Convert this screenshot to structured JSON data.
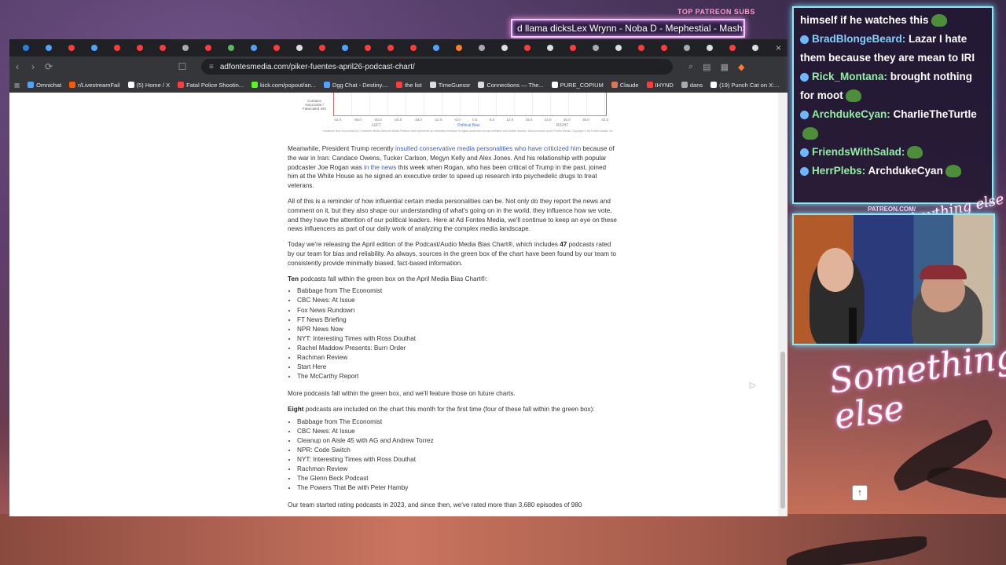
{
  "overlay": {
    "top_patreon_label": "TOP PATREON SUBS",
    "marquee_text": "d llama dicksLex Wrynn -  Noba D - Mephestial - MashStr",
    "patreon_url": "PATREON.COM/",
    "anything_else_script": "Anything else",
    "something_else_script": "Something else",
    "chat": [
      {
        "name": "",
        "message": "himself if he watches this",
        "emote": true,
        "name_color": "green",
        "badge": false
      },
      {
        "name": "BradBlongeBeard:",
        "message": " Lazar I hate them because they are mean to IRI",
        "emote": false,
        "name_color": "blue",
        "badge": true
      },
      {
        "name": "Rick_Montana:",
        "message": " brought nothing for moot",
        "emote": true,
        "name_color": "green",
        "badge": true
      },
      {
        "name": "ArchdukeCyan:",
        "message": " CharlieTheTurtle",
        "emote": true,
        "name_color": "green",
        "badge": true
      },
      {
        "name": "FriendsWithSalad:",
        "message": "",
        "emote": true,
        "name_color": "green",
        "badge": true
      },
      {
        "name": "HerrPlebs:",
        "message": " ArchdukeCyan",
        "emote": true,
        "name_color": "green",
        "badge": true
      }
    ]
  },
  "browser": {
    "url": "adfontesmedia.com/piker-fuentes-april26-podcast-chart/",
    "tab_colors": [
      "#2a7de1",
      "#4fa3ff",
      "#ff3b3b",
      "#4fa3ff",
      "#ff3b3b",
      "#ff3b3b",
      "#ff3b3b",
      "#aaaaaa",
      "#ff3b3b",
      "#5cb85c",
      "#4fa3ff",
      "#ff3b3b",
      "#dddddd",
      "#ff3b3b",
      "#4fa3ff",
      "#ff3b3b",
      "#ff3b3b",
      "#ff3b3b",
      "#4fa3ff",
      "#ff7b2b",
      "#aaaaaa",
      "#dddddd",
      "#ff3b3b",
      "#dddddd",
      "#ff3b3b",
      "#aaaaaa",
      "#dddddd",
      "#ff3b3b",
      "#ff3b3b",
      "#aaaaaa",
      "#dddddd",
      "#ff3b3b",
      "#dddddd"
    ],
    "tab_close": "×",
    "bookmarks": [
      {
        "label": "Omnichat",
        "color": "#4fa3ff"
      },
      {
        "label": "r/LivestreamFail",
        "color": "#ff5700"
      },
      {
        "label": "(5) Home / X",
        "color": "#ffffff"
      },
      {
        "label": "Fatal Police Shootin...",
        "color": "#ff3b3b"
      },
      {
        "label": "kick.com/popout/an...",
        "color": "#53fc18"
      },
      {
        "label": "Dgg Chat - Destiny....",
        "color": "#4fa3ff"
      },
      {
        "label": "the list",
        "color": "#ff3b3b"
      },
      {
        "label": "TimeGuessr",
        "color": "#dddddd"
      },
      {
        "label": "Connections — The...",
        "color": "#dddddd"
      },
      {
        "label": "PURE_COPIUM",
        "color": "#ffffff"
      },
      {
        "label": "Claude",
        "color": "#d97757"
      },
      {
        "label": "IHYND",
        "color": "#ff3b3b"
      },
      {
        "label": "dans",
        "color": "#aaaaaa"
      },
      {
        "label": "(19) Punch Cat on X:...",
        "color": "#ffffff"
      }
    ]
  },
  "chart_fragment": {
    "ylabel": "Contains Inaccurate / Fabricated Info",
    "ticks": [
      "-42.0",
      "-36.0",
      "-30.0",
      "-24.0",
      "-18.0",
      "-12.0",
      "-6.0",
      "0.0",
      "6.0",
      "12.0",
      "18.0",
      "24.0",
      "30.0",
      "36.0",
      "42.0"
    ],
    "left_label": "LEFT",
    "mid_label": "Political Bias",
    "right_label": "RIGHT",
    "footnote": "* Audience Size is provided by Consumer Media Network Media Platform and represents an estimated measure of digital audiences across websites and mobile devices. Data provided by Ad Fontes Media. Copyright © Ad Fontes Media, Inc."
  },
  "article": {
    "p1_pre": "Meanwhile, President Trump recently ",
    "p1_link1": "insulted conservative media personalities who have criticized him",
    "p1_mid": " because of the war in Iran: Candace Owens, Tucker Carlson, Megyn Kelly and Alex Jones. And his relationship with popular podcaster Joe Rogan was ",
    "p1_link2": "in the news",
    "p1_post": " this week when Rogan, who has been critical of Trump in the past, joined him at the White House as he signed an executive order to speed up research into psychedelic drugs to treat veterans.",
    "p2": "All of this is a reminder of how influential certain media personalities can be. Not only do they report the news and comment on it, but they also shape our understanding of what's going on in the world, they influence how we vote, and they have the attention of our political leaders. Here at Ad Fontes Media, we'll continue to keep an eye on these news influencers as part of our daily work of analyzing the complex media landscape.",
    "p3_pre": "Today we're releasing the April edition of the Podcast/Audio Media Bias Chart®, which includes ",
    "p3_bold": "47",
    "p3_post": " podcasts rated by our team for bias and reliability. As always, sources in the green box of the chart have been found by our team to consistently provide minimally biased, fact-based information.",
    "p4_bold": "Ten",
    "p4_post": " podcasts fall within the green box on the April Media Bias Chart®:",
    "green_box_list": [
      "Babbage from The Economist",
      "CBC News: At Issue",
      "Fox News Rundown",
      "FT News Briefing",
      "NPR News Now",
      "NYT: Interesting Times with Ross Douthat",
      "Rachel Maddow Presents: Burn Order",
      "Rachman Review",
      "Start Here",
      "The McCarthy Report"
    ],
    "p5": "More podcasts fall within the green box, and we'll feature those on future charts.",
    "p6_bold": "Eight",
    "p6_post": " podcasts are included on the chart this month for the first time (four of these fall within the green box):",
    "new_list": [
      "Babbage from The Economist",
      "CBC News: At Issue",
      "Cleanup on Aisle 45 with AG and Andrew Torrez",
      "NPR: Code Switch",
      "NYT: Interesting Times with Ross Douthat",
      "Rachman Review",
      "The Glenn Beck Podcast",
      "The Powers That Be with Peter Hamby"
    ],
    "p7": "Our team started rating podcasts in 2023, and since then, we've rated more than 3,680 episodes of 980",
    "to_top": "↑"
  }
}
